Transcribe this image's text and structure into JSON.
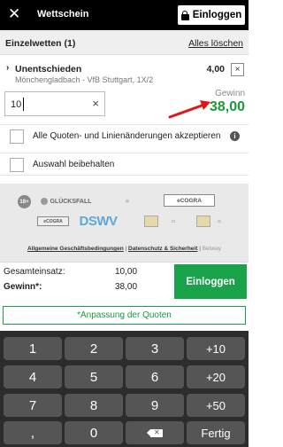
{
  "header": {
    "title": "Wettschein",
    "close_icon": "close-icon",
    "login_label": "Einloggen",
    "lock_icon": "lock-icon"
  },
  "betslip": {
    "section_label": "Einzelwetten (1)",
    "clear_all": "Alles löschen"
  },
  "bet": {
    "selection": "Unentschieden",
    "match": "Mönchengladbach - VfB Stuttgart, 1X/2",
    "odds": "4,00",
    "remove": "×",
    "stake_value": "10",
    "stake_clear": "×",
    "gain_label": "Gewinn",
    "gain_value": "38,00"
  },
  "options": [
    {
      "label": "Alle Quoten- und Linienänderungen akzeptieren",
      "checked": false
    },
    {
      "label": "Auswahl beibehalten",
      "checked": false
    }
  ],
  "logos": {
    "age": "18+",
    "gluecksfall": "GLÜCKSFALL",
    "regulator": "",
    "ecogra": "eCOGRA",
    "ecogra_small": "eCOGRA",
    "dsw": "DSWV"
  },
  "footer": {
    "agb": "Allgemeine Geschäftsbedingungen",
    "privacy": "Datenschutz & Sicherheit",
    "brand": "Betway",
    "sep": "|"
  },
  "summary": {
    "total_stake_label": "Gesamteinsatz:",
    "total_stake_value": "10,00",
    "gain_label": "Gewinn*:",
    "gain_value": "38,00",
    "bet_button": "Einloggen"
  },
  "adjust_label": "*Anpassung der Quoten",
  "keypad": {
    "keys": [
      "1",
      "2",
      "3",
      "+10",
      "4",
      "5",
      "6",
      "+20",
      "7",
      "8",
      "9",
      "+50",
      ",",
      "0",
      "backspace",
      "Fertig"
    ]
  },
  "colors": {
    "accent_green": "#1aa24a",
    "arrow_red": "#e0161b",
    "topbar": "#000000",
    "keypad_bg": "#2c2c2c"
  }
}
